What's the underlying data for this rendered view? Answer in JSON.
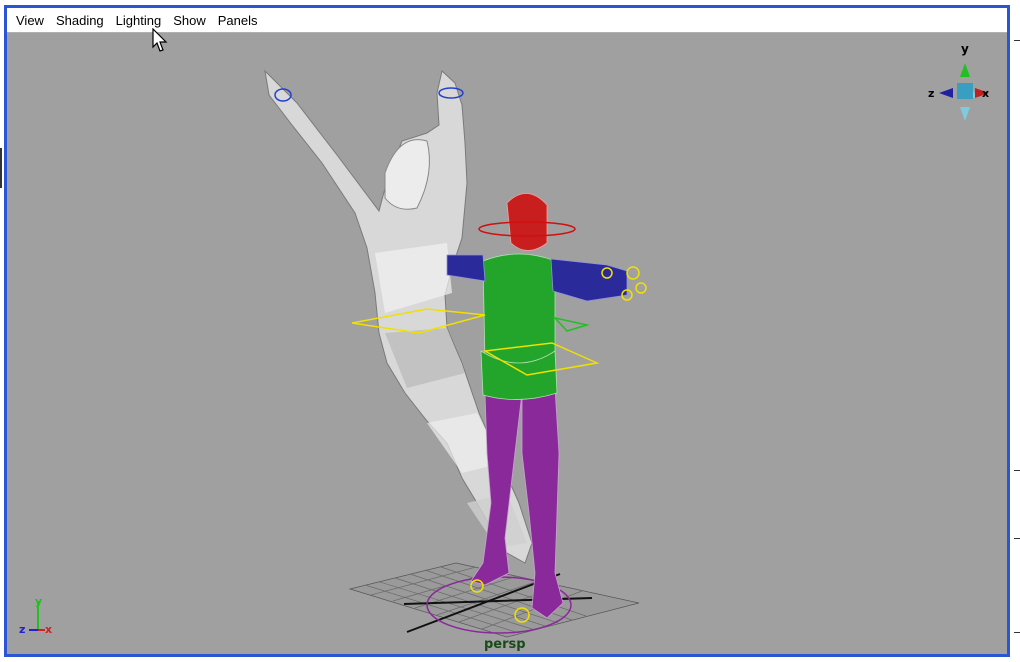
{
  "menubar": {
    "items": [
      {
        "label": "View"
      },
      {
        "label": "Shading"
      },
      {
        "label": "Lighting"
      },
      {
        "label": "Show"
      },
      {
        "label": "Panels"
      }
    ]
  },
  "viewport": {
    "camera_label": "persp",
    "background_color": "#a0a0a0",
    "view_cube_axes": {
      "y": "y",
      "z": "z",
      "x": "x"
    },
    "origin_axes": {
      "y": "y",
      "z": "z",
      "x": "x"
    }
  },
  "colors": {
    "panel_border": "#2a55d6",
    "mesh_torso": "#22a52a",
    "mesh_head": "#c81e1e",
    "mesh_arms": "#2a2a9a",
    "mesh_legs": "#8a2a9a",
    "control_curve": "#f0e000"
  }
}
